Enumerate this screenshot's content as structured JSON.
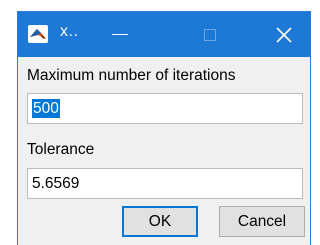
{
  "window": {
    "title": "x..",
    "close_glyph": "✕"
  },
  "form": {
    "iterations_label": "Maximum number of iterations",
    "iterations_value": "500",
    "tolerance_label": "Tolerance",
    "tolerance_value": "5.6569"
  },
  "buttons": {
    "ok_label": "OK",
    "cancel_label": "Cancel"
  },
  "icons": {
    "app": "matlab-icon",
    "minimize": "minimize-icon",
    "maximize": "maximize-icon",
    "close": "close-icon"
  },
  "colors": {
    "titlebar": "#1e79d6",
    "selection": "#0078d7",
    "dialog_bg": "#f0f0f0"
  }
}
